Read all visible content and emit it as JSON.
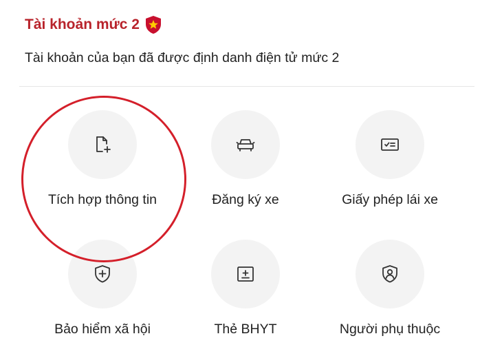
{
  "account": {
    "title": "Tài khoản mức 2",
    "badge_icon": "shield-star-icon",
    "description": "Tài khoản của bạn đã được định danh điện tử mức 2"
  },
  "services": [
    {
      "label": "Tích hợp thông tin",
      "icon": "file-add-icon"
    },
    {
      "label": "Đăng ký xe",
      "icon": "car-icon"
    },
    {
      "label": "Giấy phép lái xe",
      "icon": "license-card-icon"
    },
    {
      "label": "Bảo hiểm xã hội",
      "icon": "shield-plus-icon"
    },
    {
      "label": "Thẻ BHYT",
      "icon": "health-card-icon"
    },
    {
      "label": "Người phụ thuộc",
      "icon": "user-shield-icon"
    }
  ],
  "colors": {
    "accent": "#b8232b",
    "badge": "#c8102e",
    "badge_star": "#ffcc00",
    "icon_bg": "#f3f3f3",
    "highlight_ring": "#d41f2a"
  }
}
